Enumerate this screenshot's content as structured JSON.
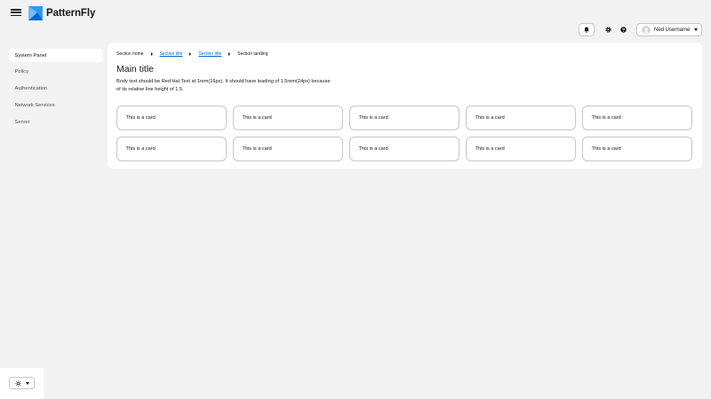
{
  "brand": {
    "name": "PatternFly"
  },
  "toolbar": {
    "notification_icon": "bell-icon",
    "settings_icon": "gear-icon",
    "help_icon": "question-circle-icon",
    "user_name": "Ned Username"
  },
  "sidebar": {
    "items": [
      {
        "label": "System Panel",
        "active": true
      },
      {
        "label": "Policy",
        "active": false
      },
      {
        "label": "Authentication",
        "active": false
      },
      {
        "label": "Network Services",
        "active": false
      },
      {
        "label": "Server",
        "active": false
      }
    ]
  },
  "main": {
    "breadcrumb": [
      "Section home",
      "Section title",
      "Section title",
      "Section landing"
    ],
    "title": "Main title",
    "body_line1": "Body text should be Red Hat Text at 1rem(16px). It should have leading of 1.5rem(24px) because",
    "body_line2": "of its relative line height of 1.5.",
    "cards": [
      "This is a card",
      "This is a card",
      "This is a card",
      "This is a card",
      "This is a card",
      "This is a card",
      "This is a card",
      "This is a card",
      "This is a card",
      "This is a card"
    ]
  },
  "theme_switcher": {
    "icon": "sun-icon"
  },
  "colors": {
    "link": "#0066cc",
    "page_bg": "#f2f2f2",
    "border": "#c7c7c7",
    "logo": "#2b9af3"
  }
}
